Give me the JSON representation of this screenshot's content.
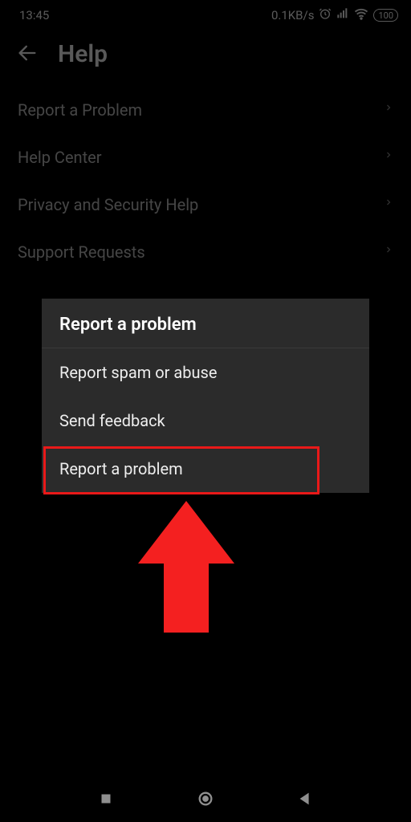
{
  "status": {
    "time": "13:45",
    "network_speed": "0.1KB/s",
    "battery": "100"
  },
  "header": {
    "title": "Help"
  },
  "menu": {
    "items": [
      {
        "label": "Report a Problem"
      },
      {
        "label": "Help Center"
      },
      {
        "label": "Privacy and Security Help"
      },
      {
        "label": "Support Requests"
      }
    ]
  },
  "sheet": {
    "title": "Report a problem",
    "items": [
      {
        "label": "Report spam or abuse"
      },
      {
        "label": "Send feedback"
      },
      {
        "label": "Report a problem"
      }
    ]
  },
  "annotation": {
    "highlight_color": "#e91919",
    "arrow_color": "#f42020"
  }
}
